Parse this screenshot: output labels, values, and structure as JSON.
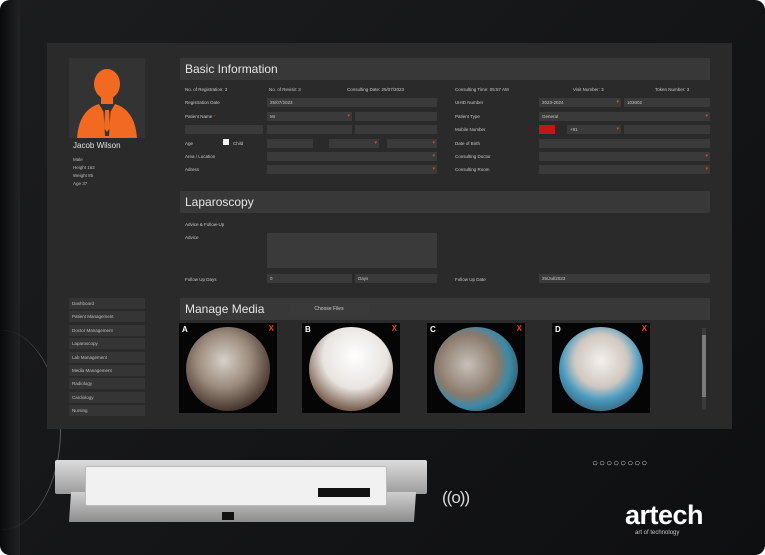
{
  "patient": {
    "name": "Jacob Wilson",
    "gender": "Male",
    "height": "Height 162",
    "weight": "Weight 85",
    "age": "Age 37"
  },
  "colors": {
    "accent": "#e04a1a",
    "panel": "#2a2a2a",
    "field": "#3a3a3a"
  },
  "sidebar": {
    "items": [
      {
        "label": "Dashboard"
      },
      {
        "label": "Patient Management"
      },
      {
        "label": "Doctor Management"
      },
      {
        "label": "Laparoscopy"
      },
      {
        "label": "Lab Management"
      },
      {
        "label": "Media Management"
      },
      {
        "label": "Radiology"
      },
      {
        "label": "Cardiology"
      },
      {
        "label": "Nursing"
      }
    ]
  },
  "basic": {
    "title": "Basic Information",
    "registrations": "No. of Registration: 3",
    "revisits": "No. of Revisit: 3",
    "consulting_date": "Consulting Date: 25/07/2023",
    "consulting_time": "Consulting Time: 05:57 AM",
    "visit_number": "Visit Number: 3",
    "token_number": "Token Number: 3",
    "registration_date_label": "Registration Date",
    "registration_date_value": "25/07/2023",
    "uhid_label": "UHID Number",
    "uhid_year": "2023-2024",
    "uhid_value": "103002",
    "patient_name_label": "Patient Name",
    "patient_name_req": "*",
    "title_value": "Mr",
    "patient_type_label": "Patient Type",
    "patient_type_value": "General",
    "mobile_label": "Mobile Number",
    "mobile_code": "+91",
    "age_label": "Age",
    "child_label": "Child",
    "dob_label": "Date of Birth",
    "area_label": "Area / Location",
    "consulting_doctor_label": "Consulting Doctor",
    "address_label": "Adress",
    "consulting_room_label": "Consulting Room"
  },
  "lap": {
    "title": "Laparoscopy",
    "advice_followup_label": "Advice & Follow-Up",
    "advice_label": "Advice",
    "followup_days_label": "Follow Up Days",
    "followup_days_value": "0",
    "days_unit": "Days",
    "followup_date_label": "Follow Up Date",
    "followup_date_value": "25/Jul/2023"
  },
  "media": {
    "title": "Manage Media",
    "choose_files": "Choose Files",
    "items": [
      {
        "letter": "A",
        "remove": "X"
      },
      {
        "letter": "B",
        "remove": "X"
      },
      {
        "letter": "C",
        "remove": "X"
      },
      {
        "letter": "D",
        "remove": "X"
      }
    ]
  },
  "device": {
    "brand": "artech",
    "tagline": "art of technology",
    "nfc_symbol": "((o))",
    "ports": "○○○○○○○○"
  }
}
